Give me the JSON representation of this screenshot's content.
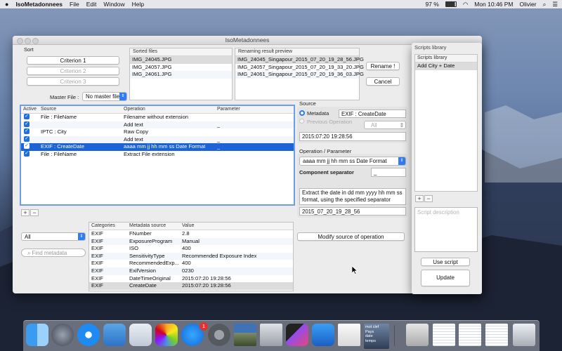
{
  "menubar": {
    "app_name": "IsoMetadonnees",
    "menus": [
      "File",
      "Edit",
      "Window",
      "Help"
    ],
    "battery": "97 %",
    "clock": "Mon 10:46 PM",
    "user": "Olivier"
  },
  "window": {
    "title": "IsoMetadonnees"
  },
  "sort": {
    "label": "Sort",
    "criteria": [
      "Criterion 1",
      "Criterion 2",
      "Criterion 3"
    ],
    "master_file_label": "Master File :",
    "master_file_value": "No master file"
  },
  "sorted_files": {
    "header": "Sorted files",
    "items": [
      "IMG_24045.JPG",
      "IMG_24057.JPG",
      "IMG_24061.JPG"
    ]
  },
  "renaming_preview": {
    "header": "Renaming result preview",
    "items": [
      "IMG_24045_Singapour_2015_07_20_19_28_56.JPG",
      "IMG_24057_Singapour_2015_07_20_19_33_20.JPG",
      "IMG_24061_Singapour_2015_07_20_19_36_03.JPG"
    ]
  },
  "buttons": {
    "rename": "Rename !",
    "cancel": "Cancel",
    "modify_source": "Modify source of operation",
    "use_script": "Use script",
    "update": "Update",
    "plus": "+",
    "minus": "−"
  },
  "operations": {
    "headers": {
      "active": "Active",
      "source": "Source",
      "operation": "Operation",
      "parameter": "Parameter"
    },
    "rows": [
      {
        "source": "File : FileName",
        "operation": "Filename without extension",
        "parameter": ""
      },
      {
        "source": "",
        "operation": "Add text",
        "parameter": "_"
      },
      {
        "source": "IPTC : City",
        "operation": "Raw Copy",
        "parameter": ""
      },
      {
        "source": "",
        "operation": "Add text",
        "parameter": "_"
      },
      {
        "source": "EXIF : CreateDate",
        "operation": "aaaa mm jj hh mm ss Date Format",
        "parameter": "_"
      },
      {
        "source": "File : FileName",
        "operation": "Extract File extension",
        "parameter": ""
      }
    ]
  },
  "source_panel": {
    "label": "Source",
    "metadata_label": "Metadata",
    "metadata_value": "EXIF : CreateDate",
    "previous_operation_label": "Previous Operation",
    "all_popup": "All",
    "value": "2015:07:20 19:28:56"
  },
  "operation_panel": {
    "label": "Operation / Parameter",
    "operation_popup": "aaaa mm jj hh mm ss Date Format",
    "component_separator_label": "Component separator",
    "component_separator_value": "_",
    "description": "Extract the date in dd mm yyyy hh mm ss format, using the specified separator",
    "result": "2015_07_20_19_28_56"
  },
  "metadata_filter": {
    "popup_value": "All",
    "search_placeholder": "Find metadata"
  },
  "metadata_table": {
    "headers": {
      "categories": "Categories",
      "source": "Metadata source",
      "value": "Value"
    },
    "rows": [
      {
        "cat": "EXIF",
        "src": "FNumber",
        "val": "2.8"
      },
      {
        "cat": "EXIF",
        "src": "ExposureProgram",
        "val": "Manual"
      },
      {
        "cat": "EXIF",
        "src": "ISO",
        "val": "400"
      },
      {
        "cat": "EXIF",
        "src": "SensitivityType",
        "val": "Recommended Exposure Index"
      },
      {
        "cat": "EXIF",
        "src": "RecommendedExp...",
        "val": "400"
      },
      {
        "cat": "EXIF",
        "src": "ExifVersion",
        "val": "0230"
      },
      {
        "cat": "EXIF",
        "src": "DateTimeOriginal",
        "val": "2015:07:20 19:28:56"
      },
      {
        "cat": "EXIF",
        "src": "CreateDate",
        "val": "2015:07:20 19:28:56"
      }
    ]
  },
  "scripts_library": {
    "title": "Scripts library",
    "header": "Scripts library",
    "items": [
      "Add City + Date"
    ],
    "description_placeholder": "Script description"
  },
  "dock": {
    "badge": "1",
    "items": [
      "finder-icon",
      "launchpad-icon",
      "safari-icon",
      "mail-icon",
      "preview-icon",
      "photos-icon",
      "app-store-icon",
      "system-preferences-icon",
      "photo-thumbnail-icon",
      "image-capture-icon",
      "final-cut-icon",
      "xcode-icon",
      "textedit-icon",
      "document-thumbnail-icon",
      "disk-icon",
      "window-thumbnail-icon",
      "window-thumbnail-icon",
      "window-thumbnail-icon",
      "trash-icon"
    ],
    "doc_lines": [
      "mot clef",
      "Pays",
      "date",
      "temps"
    ]
  }
}
